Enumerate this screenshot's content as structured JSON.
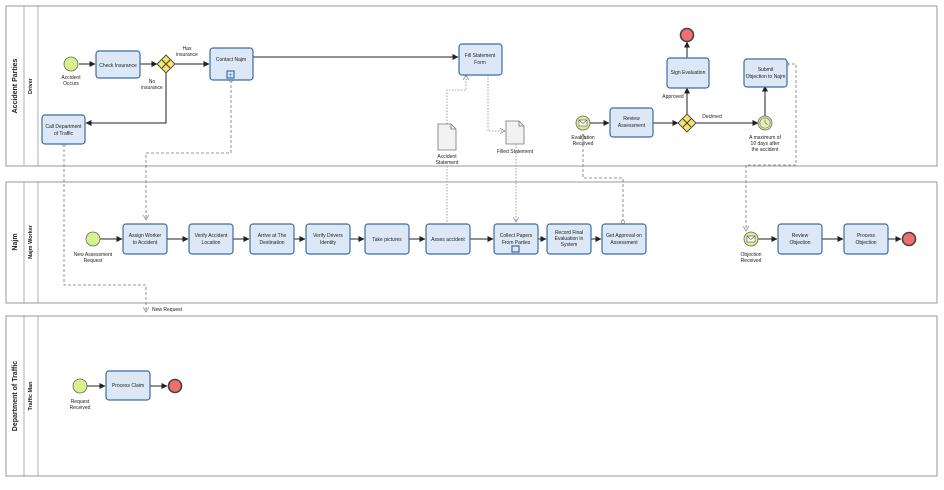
{
  "pools": [
    {
      "name": "Accident Parties",
      "lanes": [
        "Driver"
      ]
    },
    {
      "name": "Najm",
      "lanes": [
        "Najm Worker"
      ]
    },
    {
      "name": "Department of Traffic",
      "lanes": [
        "Traffic Man"
      ]
    }
  ],
  "tasks": {
    "check_insurance": [
      "Check Insurance"
    ],
    "contact_najm": [
      "Contact Najm"
    ],
    "fill_statement": [
      "Fill Statement",
      "Form"
    ],
    "call_traffic": [
      "Call Department",
      "of Traffic"
    ],
    "review_assessment": [
      "Review",
      "Assessment"
    ],
    "sign_evaluation": [
      "Sign Evaluation"
    ],
    "submit_objection": [
      "Submit",
      "Objection to Najm"
    ],
    "assign_worker": [
      "Assign Worker",
      "to Accident"
    ],
    "verify_location": [
      "Verify Accident",
      "Location"
    ],
    "arrive_destination": [
      "Arrive at The",
      "Destination"
    ],
    "verify_drivers": [
      "Verify Drivers",
      "Identity"
    ],
    "take_pictures": [
      "Take pictures"
    ],
    "asses_accident": [
      "Asses accident"
    ],
    "collect_papers": [
      "Collect Papers",
      "From Parties"
    ],
    "record_evaluation": [
      "Record Final",
      "Evaluation in",
      "System"
    ],
    "get_approval": [
      "Get Approval on",
      "Assessment"
    ],
    "review_objection": [
      "Review",
      "Objection"
    ],
    "process_objection": [
      "Process",
      "Objection"
    ],
    "process_claim": [
      "Process Claim"
    ]
  },
  "event_labels": {
    "accident_occurs": [
      "Accident",
      "Occurs"
    ],
    "evaluation_received": [
      "Evaluation",
      "Received"
    ],
    "timer_note": [
      "A maximum of",
      "10 days after",
      "the accident"
    ],
    "new_assessment": [
      "New Assessment",
      "Request"
    ],
    "objection_received": [
      "Objection",
      "Received"
    ],
    "new_request": [
      "New Request"
    ],
    "request_received": [
      "Request",
      "Received"
    ]
  },
  "gateway_labels": {
    "has_insurance": [
      "Has",
      "insurance"
    ],
    "no_insurance": [
      "No",
      "insurance"
    ],
    "approved": [
      "Approved"
    ],
    "declined": [
      "Declined"
    ]
  },
  "documents": {
    "accident_statement": [
      "Accident",
      "Statement"
    ],
    "filled_statement": [
      "Filled Statement"
    ]
  },
  "colors": {
    "task_fill": "#dce8f5",
    "task_stroke": "#3b6ea5",
    "start_fill": "#d9f08f",
    "end_fill": "#f26f70",
    "gateway_fill": "#f6e56a"
  }
}
